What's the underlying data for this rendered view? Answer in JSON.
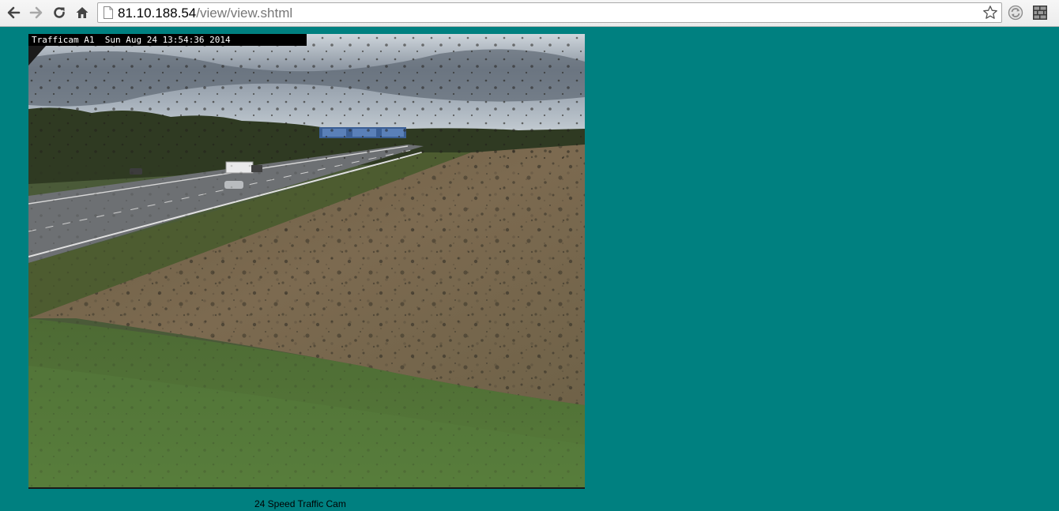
{
  "browser": {
    "url_host": "81.10.188.54",
    "url_path": "/view/view.shtml",
    "icons": {
      "back": "arrow-left",
      "forward": "arrow-right",
      "reload": "reload",
      "home": "home",
      "page": "document",
      "bookmark": "star",
      "ext1": "sync-circle",
      "ext2": "brick-wall"
    }
  },
  "camera": {
    "overlay_text": "Trafficam A1  Sun Aug 24 13:54:36 2014",
    "caption": "24 Speed Traffic Cam"
  },
  "colors": {
    "page_background": "#008080",
    "toolbar_background": "#efefef"
  }
}
